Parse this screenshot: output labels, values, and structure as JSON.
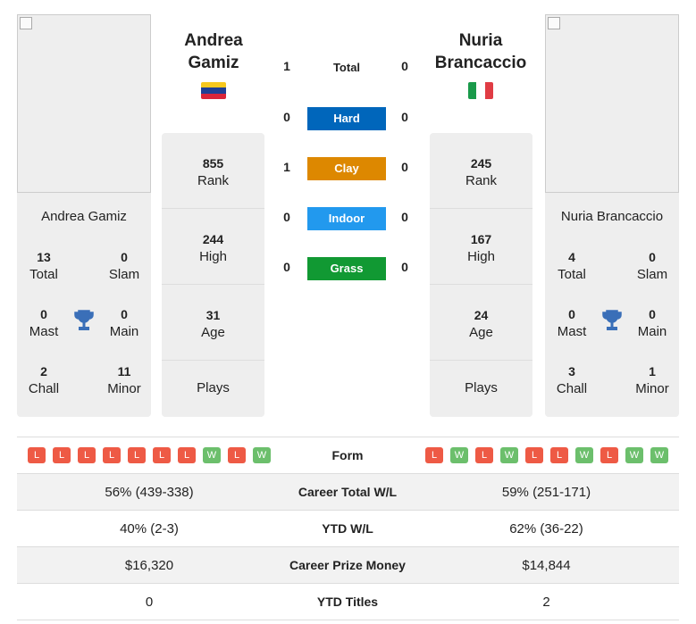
{
  "player1": {
    "name": "Andrea Gamiz",
    "name_line1": "Andrea",
    "name_line2": "Gamiz",
    "flag": "venezuela",
    "total": "13",
    "slam": "0",
    "mast": "0",
    "main": "0",
    "chall": "2",
    "minor": "11",
    "rank": "855",
    "high": "244",
    "age": "31",
    "plays": ""
  },
  "player2": {
    "name": "Nuria Brancaccio",
    "name_line1": "Nuria",
    "name_line2": "Brancaccio",
    "flag": "italy",
    "total": "4",
    "slam": "0",
    "mast": "0",
    "main": "0",
    "chall": "3",
    "minor": "1",
    "rank": "245",
    "high": "167",
    "age": "24",
    "plays": ""
  },
  "labels": {
    "total": "Total",
    "slam": "Slam",
    "mast": "Mast",
    "main": "Main",
    "chall": "Chall",
    "minor": "Minor",
    "rank": "Rank",
    "high": "High",
    "age": "Age",
    "plays": "Plays"
  },
  "h2h": [
    {
      "label": "Total",
      "p1": "1",
      "p2": "0",
      "color": ""
    },
    {
      "label": "Hard",
      "p1": "0",
      "p2": "0",
      "color": "#0066bb"
    },
    {
      "label": "Clay",
      "p1": "1",
      "p2": "0",
      "color": "#dd8800"
    },
    {
      "label": "Indoor",
      "p1": "0",
      "p2": "0",
      "color": "#2299ee"
    },
    {
      "label": "Grass",
      "p1": "0",
      "p2": "0",
      "color": "#119933"
    }
  ],
  "form": {
    "label": "Form",
    "p1": [
      "L",
      "L",
      "L",
      "L",
      "L",
      "L",
      "L",
      "W",
      "L",
      "W"
    ],
    "p2": [
      "L",
      "W",
      "L",
      "W",
      "L",
      "L",
      "W",
      "L",
      "W",
      "W"
    ]
  },
  "rows": [
    {
      "label": "Career Total W/L",
      "p1": "56% (439-338)",
      "p2": "59% (251-171)"
    },
    {
      "label": "YTD W/L",
      "p1": "40% (2-3)",
      "p2": "62% (36-22)"
    },
    {
      "label": "Career Prize Money",
      "p1": "$16,320",
      "p2": "$14,844"
    },
    {
      "label": "YTD Titles",
      "p1": "0",
      "p2": "2"
    }
  ]
}
